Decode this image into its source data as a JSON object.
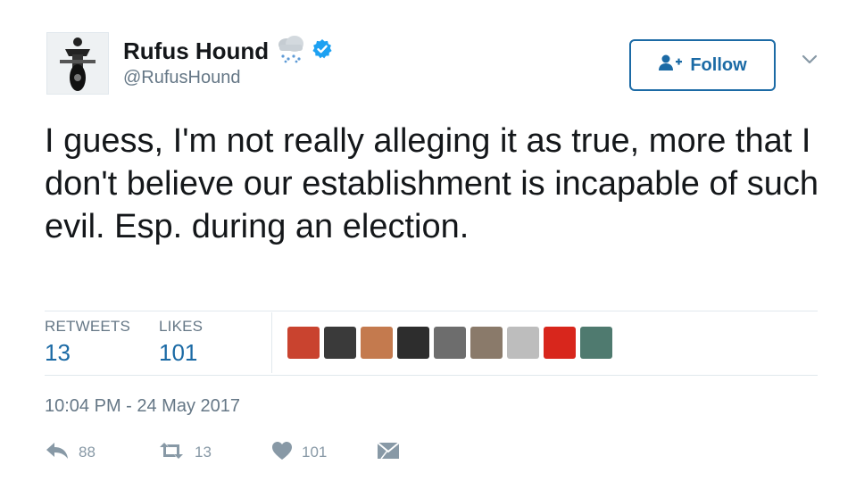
{
  "user": {
    "display_name": "Rufus Hound",
    "handle": "@RufusHound",
    "avatar_icon": "motorcycle-rider-avatar",
    "emoji_icon": "snow-cloud-icon",
    "verified_icon": "verified-badge-icon"
  },
  "follow_button": {
    "label": "Follow",
    "icon": "add-user-icon"
  },
  "tweet": {
    "text": "I guess, I'm not really alleging it as true, more that I don't believe our establishment is incapable of such evil. Esp. during an election."
  },
  "stats": {
    "retweets_label": "RETWEETS",
    "retweets_value": "13",
    "likes_label": "LIKES",
    "likes_value": "101"
  },
  "likers": [
    {
      "color": "#c9432f"
    },
    {
      "color": "#3a3a3a"
    },
    {
      "color": "#c47a4e"
    },
    {
      "color": "#2d2d2d"
    },
    {
      "color": "#6d6d6d"
    },
    {
      "color": "#8a7a6a"
    },
    {
      "color": "#bdbdbd"
    },
    {
      "color": "#d8261c"
    },
    {
      "color": "#4f7a6f"
    }
  ],
  "timestamp": "10:04 PM - 24 May 2017",
  "actions": {
    "reply_count": "88",
    "retweet_count": "13",
    "like_count": "101"
  },
  "colors": {
    "accent": "#1b6aa5",
    "verified": "#1da1f2",
    "muted": "#657786",
    "action": "#8899a6"
  }
}
